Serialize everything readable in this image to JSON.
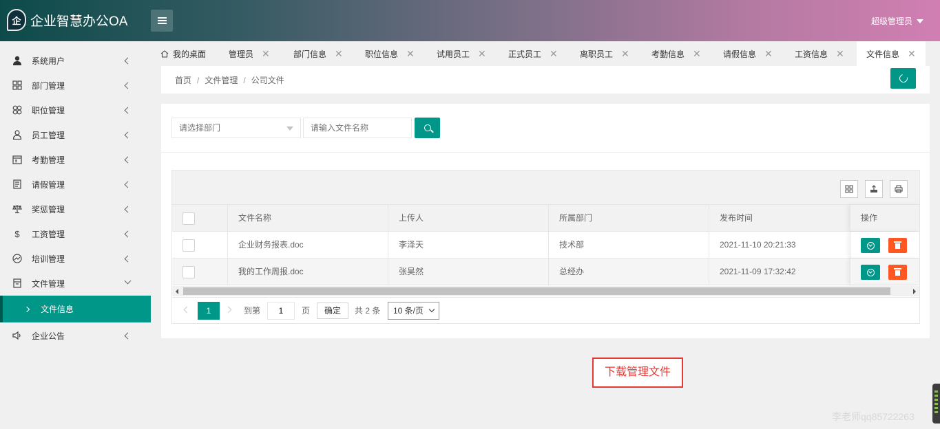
{
  "app": {
    "title": "企业智慧办公OA",
    "logo_char": "企"
  },
  "user": {
    "name": "超级管理员"
  },
  "sidebar": {
    "items": [
      {
        "label": "系统用户",
        "icon": "user-icon"
      },
      {
        "label": "部门管理",
        "icon": "grid-icon"
      },
      {
        "label": "职位管理",
        "icon": "flower-icon"
      },
      {
        "label": "员工管理",
        "icon": "person-icon"
      },
      {
        "label": "考勤管理",
        "icon": "calendar-icon"
      },
      {
        "label": "请假管理",
        "icon": "form-icon"
      },
      {
        "label": "奖惩管理",
        "icon": "scale-icon"
      },
      {
        "label": "工资管理",
        "icon": "dollar-icon"
      },
      {
        "label": "培训管理",
        "icon": "chart-icon"
      },
      {
        "label": "文件管理",
        "icon": "file-icon"
      },
      {
        "label": "企业公告",
        "icon": "speaker-icon"
      }
    ],
    "active_sub": "文件信息"
  },
  "tabs": [
    {
      "label": "我的桌面"
    },
    {
      "label": "管理员"
    },
    {
      "label": "部门信息"
    },
    {
      "label": "职位信息"
    },
    {
      "label": "试用员工"
    },
    {
      "label": "正式员工"
    },
    {
      "label": "离职员工"
    },
    {
      "label": "考勤信息"
    },
    {
      "label": "请假信息"
    },
    {
      "label": "工资信息"
    },
    {
      "label": "文件信息"
    }
  ],
  "breadcrumb": {
    "home": "首页",
    "section": "文件管理",
    "current": "公司文件"
  },
  "filters": {
    "dept_placeholder": "请选择部门",
    "name_placeholder": "请输入文件名称"
  },
  "table": {
    "headers": {
      "name": "文件名称",
      "uploader": "上传人",
      "dept": "所属部门",
      "time": "发布时间",
      "ops": "操作"
    },
    "rows": [
      {
        "name": "企业财务报表.doc",
        "uploader": "李泽天",
        "dept": "技术部",
        "time": "2021-11-10 20:21:33"
      },
      {
        "name": "我的工作周报.doc",
        "uploader": "张昊然",
        "dept": "总经办",
        "time": "2021-11-09 17:32:42"
      }
    ]
  },
  "pager": {
    "current": "1",
    "goto_label": "到第",
    "goto_value": "1",
    "page_unit": "页",
    "confirm": "确定",
    "total": "共 2 条",
    "page_size": "10 条/页"
  },
  "annotation": "下载管理文件",
  "watermark": "李老师qq85722263",
  "colors": {
    "primary": "#009688",
    "danger": "#ff5722",
    "annotation": "#e53935"
  }
}
